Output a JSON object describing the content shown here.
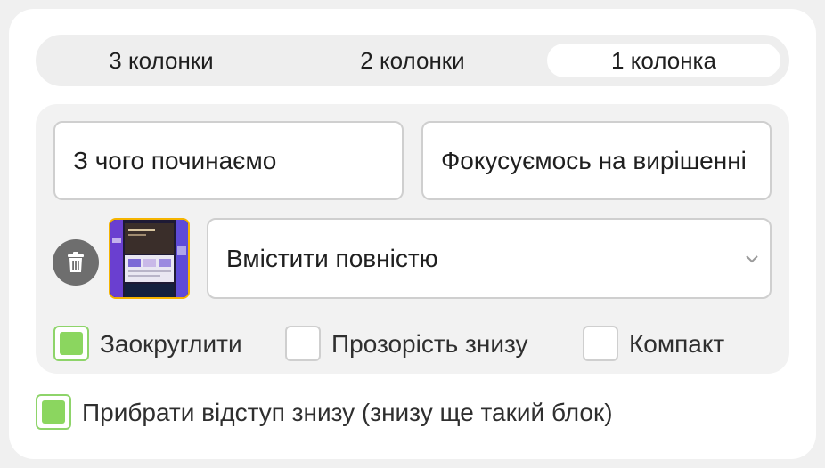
{
  "layout_tabs": {
    "options": [
      "3 колонки",
      "2 колонки",
      "1 колонка"
    ],
    "selected": "1 колонка"
  },
  "inputs": {
    "title_value": "З чого починаємо",
    "subtitle_value": "Фокусуємось на вирішенні"
  },
  "image": {
    "fit_select_value": "Вмістити повністю",
    "thumb_border_color": "#f5b400"
  },
  "options": {
    "rounded": {
      "label": "Заокруглити",
      "checked": true
    },
    "fade_bottom": {
      "label": "Прозорість знизу",
      "checked": false
    },
    "compact": {
      "label": "Компакт",
      "checked": false
    }
  },
  "remove_bottom_padding": {
    "label": "Прибрати відступ знизу (знизу ще такий блок)",
    "checked": true
  },
  "colors": {
    "accent_green": "#8bd65f",
    "panel_bg": "#f2f2f2"
  },
  "icons": {
    "delete": "trash-icon",
    "dropdown": "chevron-down-icon"
  }
}
